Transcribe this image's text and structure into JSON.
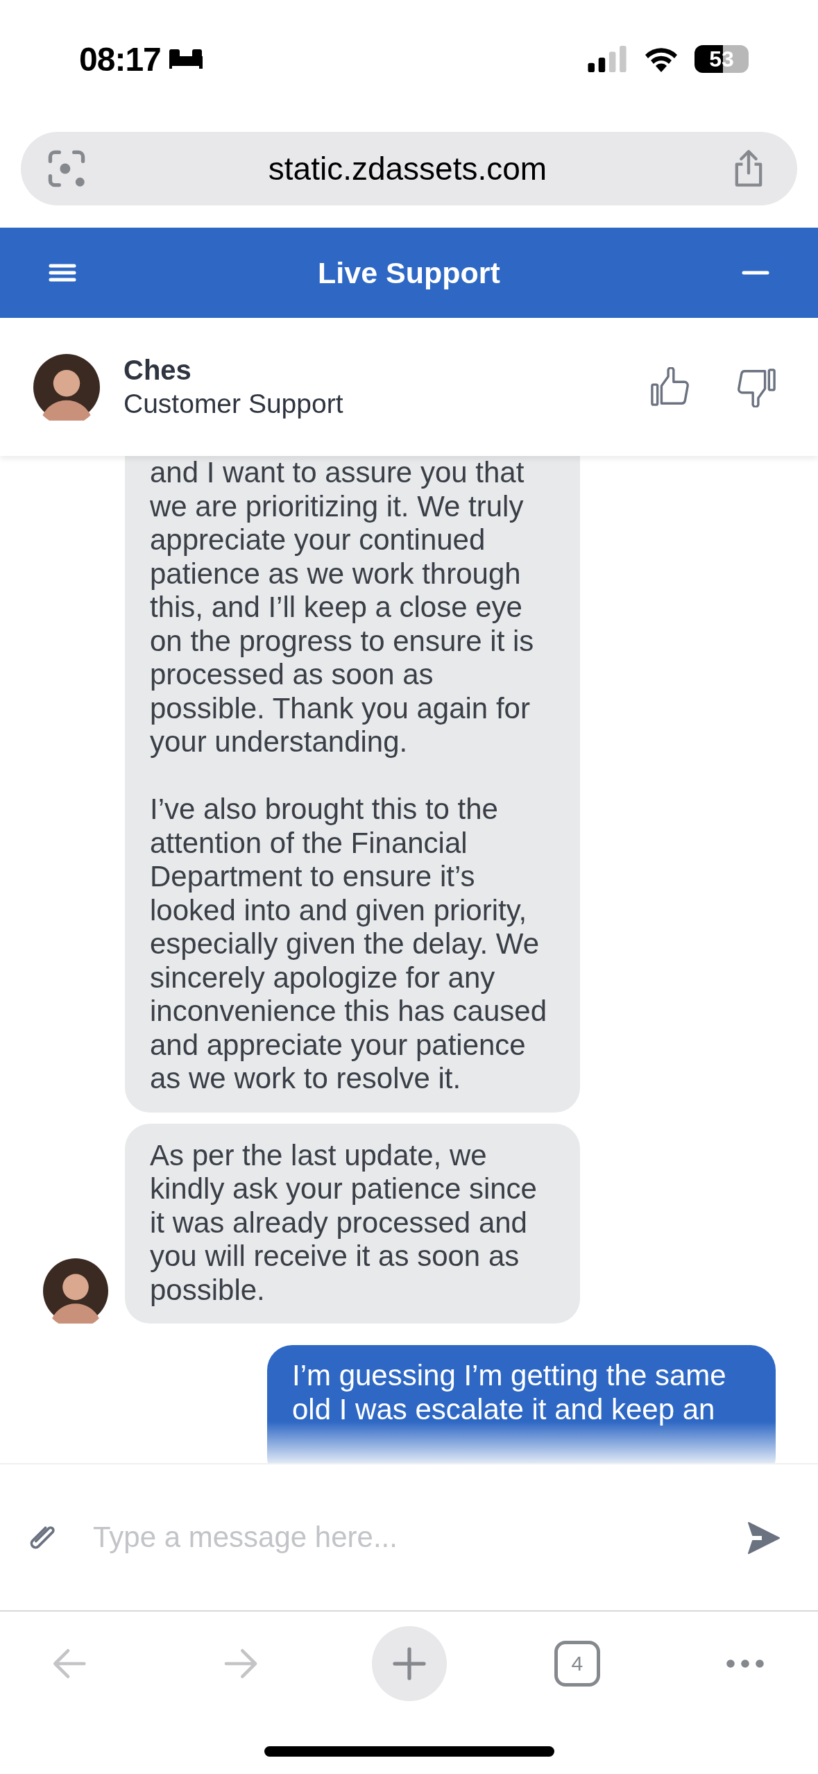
{
  "status_bar": {
    "time": "08:17",
    "battery": "53"
  },
  "address_bar": {
    "url": "static.zdassets.com"
  },
  "chat_header": {
    "title": "Live Support"
  },
  "agent": {
    "name": "Ches",
    "role": "Customer Support"
  },
  "messages": [
    {
      "kind": "agent",
      "show_avatar": false,
      "paragraphs": [
        "and I want to assure you that we are prioritizing it. We truly appreciate your continued patience as we work through this, and I’ll keep a close eye on the progress to ensure it is processed as soon as possible. Thank you again for your understanding.",
        "I’ve also brought this to the attention of the Financial Department to ensure it’s looked into and given priority, especially given the delay. We sincerely apologize for any inconvenience this has caused and appreciate your patience as we work to resolve it."
      ]
    },
    {
      "kind": "agent",
      "show_avatar": true,
      "paragraphs": [
        "As per the last update, we kindly ask your patience since it was already processed and you will receive it as soon as possible."
      ]
    },
    {
      "kind": "user",
      "paragraphs": [
        "I’m guessing I’m getting the same old I was escalate it and keep an"
      ]
    }
  ],
  "composer": {
    "placeholder": "Type a message here..."
  },
  "toolbar": [
    {
      "kind": "back",
      "disabled": true
    },
    {
      "kind": "forward",
      "disabled": true
    },
    {
      "kind": "new-tab",
      "disabled": false
    },
    {
      "kind": "tabs",
      "label": "4",
      "disabled": false
    },
    {
      "kind": "more",
      "disabled": false
    }
  ]
}
